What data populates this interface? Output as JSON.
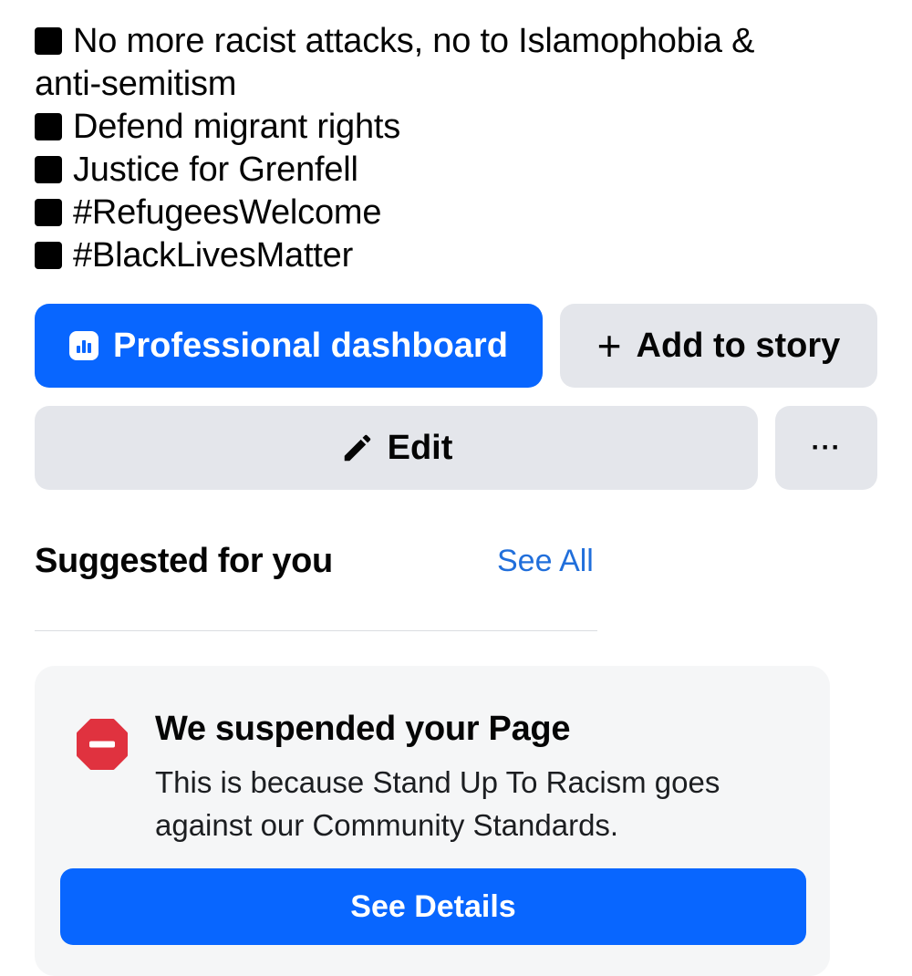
{
  "bio": {
    "line1": "No more racist attacks, no to Islamophobia &",
    "line1_cont": "anti-semitism",
    "line2": "Defend migrant rights",
    "line3": "Justice for Grenfell",
    "line4": "#RefugeesWelcome",
    "line5": "#BlackLivesMatter"
  },
  "actions": {
    "dashboard_label": "Professional dashboard",
    "dashboard_icon": "dashboard-icon",
    "story_label": "Add to story",
    "story_icon": "plus-icon",
    "edit_label": "Edit",
    "edit_icon": "pencil-icon",
    "more_label": "···"
  },
  "suggested": {
    "title": "Suggested for you",
    "see_all": "See All"
  },
  "notice": {
    "icon": "stop-icon",
    "title": "We suspended your Page",
    "body": "This is because Stand Up To Racism goes against our Community Standards.",
    "button": "See Details"
  },
  "colors": {
    "primary": "#0866ff",
    "secondary_button": "#e4e6eb",
    "link": "#216fdb",
    "stop": "#e0323f"
  }
}
